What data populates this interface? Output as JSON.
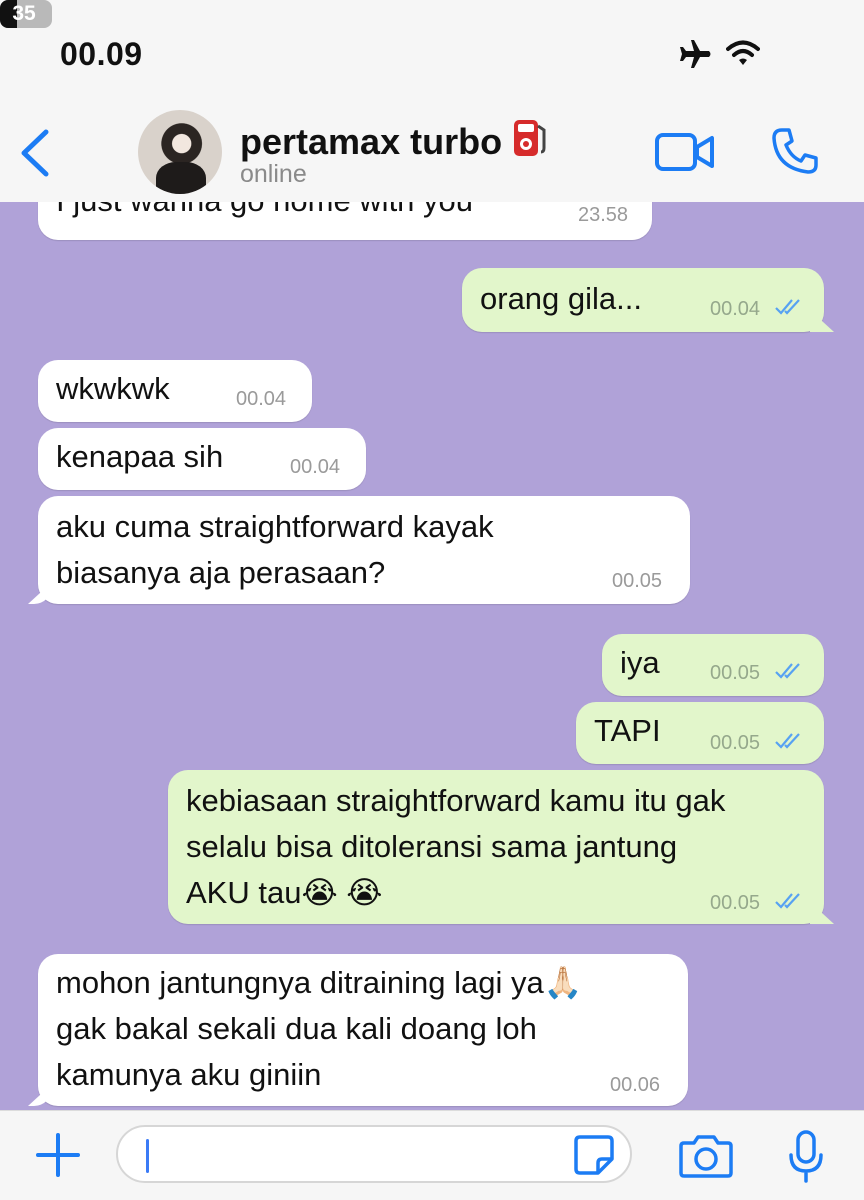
{
  "status_bar": {
    "time": "00.09",
    "battery": "35"
  },
  "header": {
    "contact_name": "pertamax turbo",
    "status": "online"
  },
  "messages": [
    {
      "dir": "in",
      "lines": [
        "I just wanna go home with you"
      ],
      "time": "23.58"
    },
    {
      "dir": "out",
      "lines": [
        "orang gila..."
      ],
      "time": "00.04",
      "read": true
    },
    {
      "dir": "in",
      "lines": [
        "wkwkwk"
      ],
      "time": "00.04"
    },
    {
      "dir": "in",
      "lines": [
        "kenapaa sih"
      ],
      "time": "00.04"
    },
    {
      "dir": "in",
      "lines": [
        "aku cuma straightforward kayak",
        "biasanya aja perasaan?"
      ],
      "time": "00.05"
    },
    {
      "dir": "out",
      "lines": [
        "iya"
      ],
      "time": "00.05",
      "read": true
    },
    {
      "dir": "out",
      "lines": [
        "TAPI"
      ],
      "time": "00.05",
      "read": true
    },
    {
      "dir": "out",
      "lines": [
        "kebiasaan straightforward kamu itu gak",
        "selalu bisa ditoleransi sama jantung",
        "AKU tau😭 😭"
      ],
      "time": "00.05",
      "read": true
    },
    {
      "dir": "in",
      "lines": [
        "mohon jantungnya ditraining lagi ya🙏🏻",
        "gak bakal sekali dua kali doang loh",
        "kamunya aku giniin"
      ],
      "time": "00.06"
    }
  ],
  "input": {
    "placeholder": ""
  },
  "colors": {
    "accent": "#1c7cf4",
    "chat_bg": "#b0a2d8",
    "outgoing": "#e2f6cb",
    "incoming": "#ffffff",
    "tick": "#57a2f2"
  }
}
